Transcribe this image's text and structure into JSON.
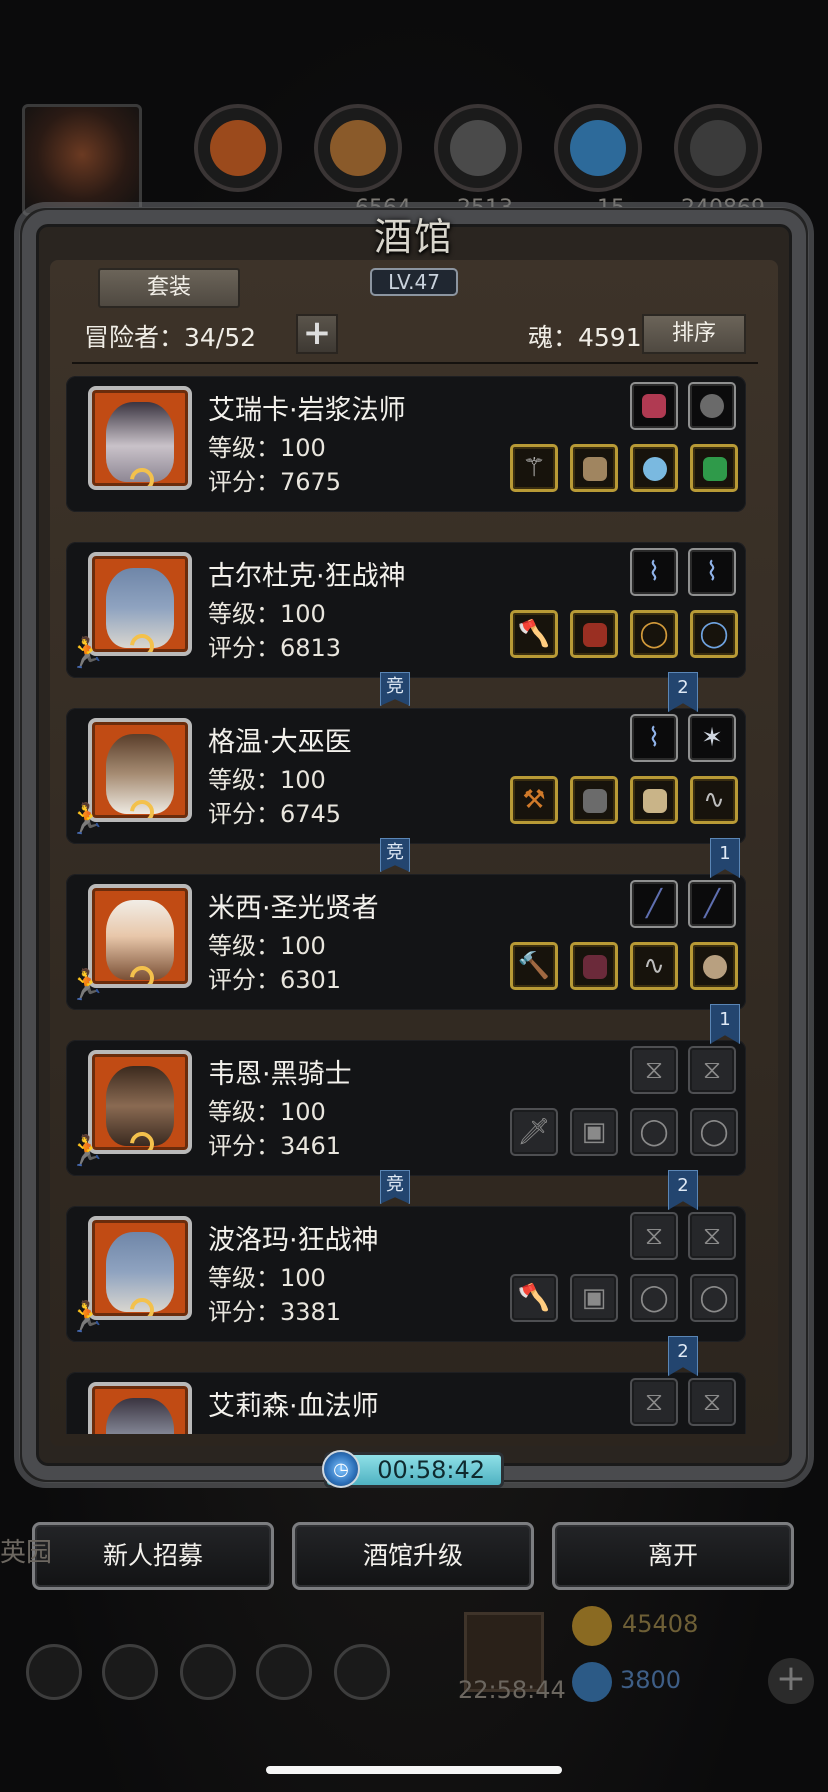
{
  "top_resources": [
    "",
    "6564",
    "2513",
    "15",
    "240869"
  ],
  "panel": {
    "title": "酒馆",
    "level": "LV.47",
    "set_button": "套装",
    "adventurers_label": "冒险者：34/52",
    "plus_button": "+",
    "soul_label": "魂：4591",
    "sort_button": "排序"
  },
  "heroes": [
    {
      "name": "艾瑞卡·岩浆法师",
      "level": "等级：100",
      "score": "评分：7675"
    },
    {
      "name": "古尔杜克·狂战神",
      "level": "等级：100",
      "score": "评分：6813"
    },
    {
      "name": "格温·大巫医",
      "level": "等级：100",
      "score": "评分：6745"
    },
    {
      "name": "米西·圣光贤者",
      "level": "等级：100",
      "score": "评分：6301"
    },
    {
      "name": "韦恩·黑骑士",
      "level": "等级：100",
      "score": "评分：3461"
    },
    {
      "name": "波洛玛·狂战神",
      "level": "等级：100",
      "score": "评分：3381"
    },
    {
      "name": "艾莉森·血法师",
      "level": "",
      "score": ""
    }
  ],
  "tabs": {
    "compete": "竞",
    "num_2": "2",
    "num_1": "1"
  },
  "timer": "00:58:42",
  "buttons": {
    "recruit": "新人招募",
    "upgrade": "酒馆升级",
    "leave": "离开"
  },
  "footer": {
    "clock": "22:58:44",
    "gold": "45408",
    "gems": "3800",
    "left_text": "英园"
  },
  "colors": {
    "portrait_orange": "#c14b14",
    "gold_frame": "#b89a36",
    "timer_cyan": "#8fe0e7",
    "tab_blue": "#23456f"
  }
}
